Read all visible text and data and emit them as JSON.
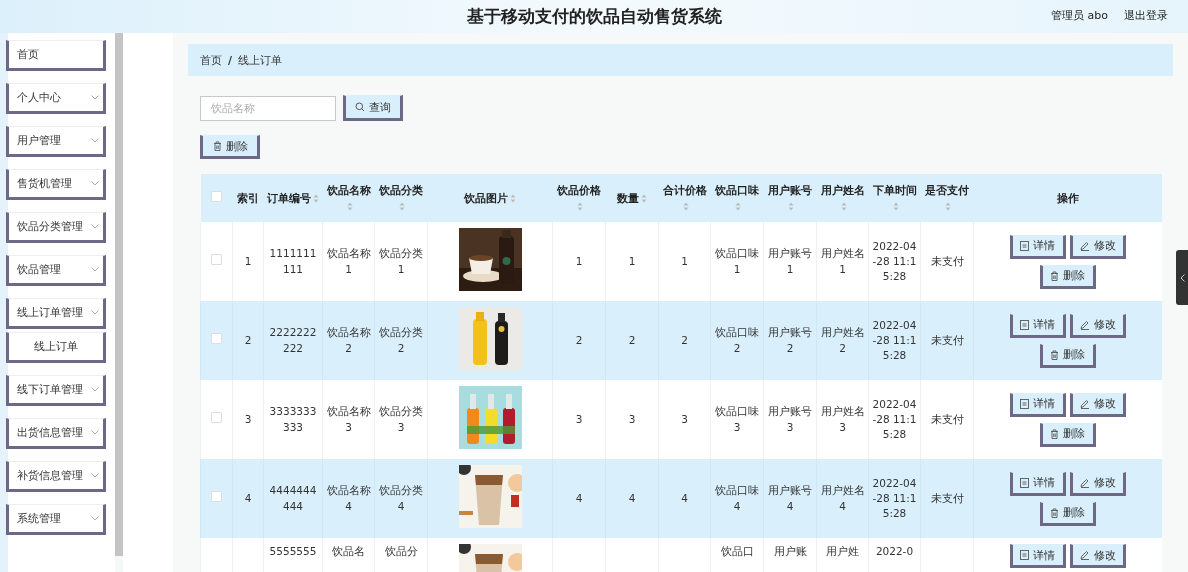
{
  "header": {
    "title": "基于移动支付的饮品自动售货系统",
    "user": "管理员 abo",
    "logout": "退出登录"
  },
  "sidebar": {
    "items": [
      {
        "label": "首页",
        "kind": "link"
      },
      {
        "label": "个人中心",
        "kind": "submenu"
      },
      {
        "label": "用户管理",
        "kind": "submenu"
      },
      {
        "label": "售货机管理",
        "kind": "submenu"
      },
      {
        "label": "饮品分类管理",
        "kind": "submenu"
      },
      {
        "label": "饮品管理",
        "kind": "submenu"
      },
      {
        "label": "线上订单管理",
        "kind": "submenu",
        "children": [
          {
            "label": "线上订单"
          }
        ]
      },
      {
        "label": "线下订单管理",
        "kind": "submenu"
      },
      {
        "label": "出货信息管理",
        "kind": "submenu"
      },
      {
        "label": "补货信息管理",
        "kind": "submenu"
      },
      {
        "label": "系统管理",
        "kind": "submenu"
      }
    ]
  },
  "breadcrumb": {
    "items": [
      "首页",
      "线上订单"
    ],
    "separator": "/"
  },
  "search": {
    "placeholder": "饮品名称",
    "button": "查询"
  },
  "bulk_delete": "删除",
  "table": {
    "all_checked": false,
    "columns": [
      {
        "label": "索引",
        "sortable": false
      },
      {
        "label": "订单编号",
        "sortable": true
      },
      {
        "label": "饮品名称",
        "sortable": true
      },
      {
        "label": "饮品分类",
        "sortable": true
      },
      {
        "label": "饮品图片",
        "sortable": true
      },
      {
        "label": "饮品价格",
        "sortable": true
      },
      {
        "label": "数量",
        "sortable": true
      },
      {
        "label": "合计价格",
        "sortable": true
      },
      {
        "label": "饮品口味",
        "sortable": true
      },
      {
        "label": "用户账号",
        "sortable": true
      },
      {
        "label": "用户姓名",
        "sortable": true
      },
      {
        "label": "下单时间",
        "sortable": true
      },
      {
        "label": "是否支付",
        "sortable": true
      },
      {
        "label": "操作",
        "sortable": false
      }
    ],
    "rows": [
      {
        "kind": "full",
        "checked": false,
        "cells": [
          "1",
          "1111111111",
          "饮品名称1",
          "饮品分类1",
          null,
          "1",
          "1",
          "1",
          "饮品口味1",
          "用户账号1",
          "用户姓名1",
          "2022-04-28 11:15:28",
          "未支付"
        ],
        "actions": [
          "详情",
          "修改",
          "删除"
        ]
      },
      {
        "kind": "full",
        "checked": false,
        "cells": [
          "2",
          "2222222222",
          "饮品名称2",
          "饮品分类2",
          null,
          "2",
          "2",
          "2",
          "饮品口味2",
          "用户账号2",
          "用户姓名2",
          "2022-04-28 11:15:28",
          "未支付"
        ],
        "actions": [
          "详情",
          "修改",
          "删除"
        ]
      },
      {
        "kind": "full",
        "checked": false,
        "cells": [
          "3",
          "3333333333",
          "饮品名称3",
          "饮品分类3",
          null,
          "3",
          "3",
          "3",
          "饮品口味3",
          "用户账号3",
          "用户姓名3",
          "2022-04-28 11:15:28",
          "未支付"
        ],
        "actions": [
          "详情",
          "修改",
          "删除"
        ]
      },
      {
        "kind": "full",
        "checked": false,
        "cells": [
          "4",
          "4444444444",
          "饮品名称4",
          "饮品分类4",
          null,
          "4",
          "4",
          "4",
          "饮品口味4",
          "用户账号4",
          "用户姓名4",
          "2022-04-28 11:15:28",
          "未支付"
        ],
        "actions": [
          "详情",
          "修改",
          "删除"
        ]
      },
      {
        "kind": "partial",
        "cells": [
          null,
          "5555555",
          "饮品名",
          "饮品分",
          null,
          null,
          null,
          null,
          "饮品口",
          "用户账",
          "用户姓",
          "2022-0",
          null
        ],
        "actions": [
          "详情",
          "修改"
        ]
      }
    ]
  }
}
